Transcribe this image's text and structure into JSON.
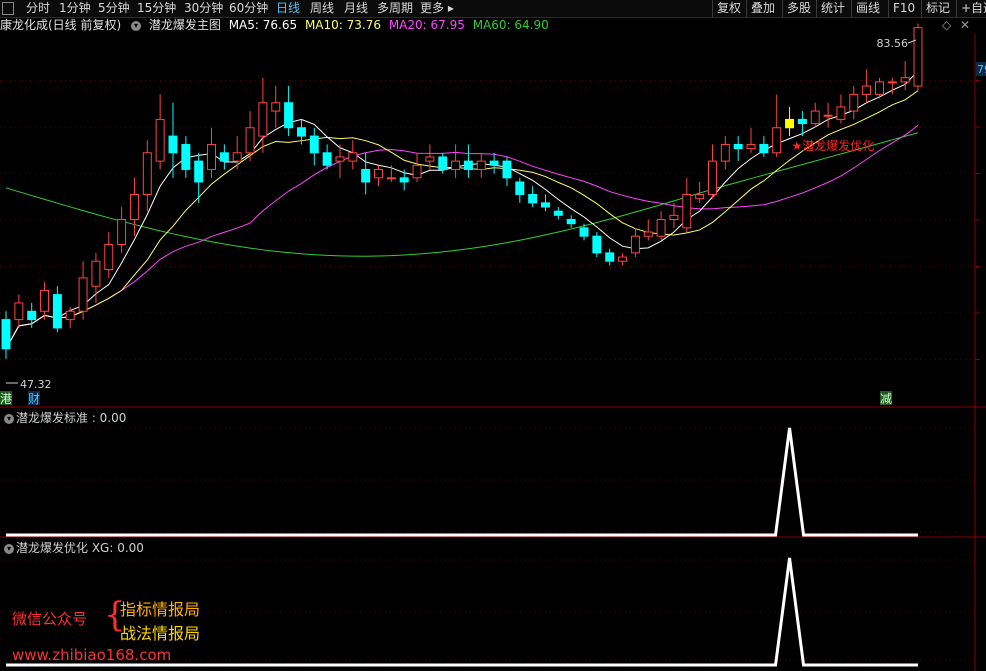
{
  "toolbar": {
    "left_items": [
      "分时",
      "1分钟",
      "5分钟",
      "15分钟",
      "30分钟",
      "60分钟",
      "日线",
      "周线",
      "月线",
      "多周期",
      "更多"
    ],
    "active": "日线",
    "more_caret": "▸",
    "right_items": [
      "复权",
      "叠加",
      "多股",
      "统计",
      "画线",
      "F10",
      "标记",
      "+自选"
    ]
  },
  "info": {
    "stock": "康龙化成(日线 前复权)",
    "indicator": "潜龙爆发主图",
    "ma5": "MA5: 76.65",
    "ma10": "MA10: 73.76",
    "ma20": "MA20: 67.95",
    "ma60": "MA60: 64.90",
    "right_icons": [
      "diamond-icon",
      "close-icon"
    ]
  },
  "colors": {
    "ma5": "#ffffff",
    "ma10": "#ffff66",
    "ma20": "#ff44ff",
    "ma60": "#33cc33",
    "up": "#ff4444",
    "down": "#00ffff",
    "signal": "#ffff00",
    "annotation": "#ff2222"
  },
  "main_chart": {
    "high_label": "83.56",
    "low_label": "47.32",
    "right_price": "79",
    "signal_text": "★潜龙爆发优化",
    "bottom_tags": [
      "港",
      "财",
      "减"
    ]
  },
  "chart_data": {
    "type": "candlestick",
    "ylim": [
      45,
      86
    ],
    "candles": [
      [
        52,
        48.5,
        53,
        47.3
      ],
      [
        52,
        54,
        55,
        51
      ],
      [
        53,
        52,
        54,
        51
      ],
      [
        53,
        55.5,
        56.5,
        52
      ],
      [
        55,
        51,
        56,
        50.5
      ],
      [
        52,
        53,
        53.5,
        51
      ],
      [
        53,
        57,
        59,
        52
      ],
      [
        56,
        59,
        60,
        54
      ],
      [
        58,
        61,
        62.5,
        57
      ],
      [
        61,
        64,
        65.5,
        60
      ],
      [
        64,
        67,
        69,
        62
      ],
      [
        67,
        72,
        73.5,
        65
      ],
      [
        71,
        76,
        79,
        70
      ],
      [
        74,
        72,
        78,
        69
      ],
      [
        73,
        70,
        74,
        69
      ],
      [
        71,
        68.5,
        72,
        66
      ],
      [
        70,
        73,
        75,
        69
      ],
      [
        72,
        71,
        73,
        70
      ],
      [
        71,
        72,
        74,
        70
      ],
      [
        72,
        75,
        77,
        71
      ],
      [
        74,
        78,
        81,
        72
      ],
      [
        77,
        78,
        80,
        75
      ],
      [
        78,
        75,
        80,
        74
      ],
      [
        75,
        74,
        76,
        73
      ],
      [
        74,
        72,
        75,
        70.5
      ],
      [
        72,
        70.5,
        73,
        70
      ],
      [
        71,
        71.5,
        73,
        69
      ],
      [
        71,
        72,
        73.5,
        70
      ],
      [
        70,
        68.5,
        72,
        67
      ],
      [
        69,
        70,
        70.5,
        68
      ],
      [
        69,
        69,
        70.5,
        68.5
      ],
      [
        69,
        68.5,
        70,
        67.5
      ],
      [
        69,
        70.5,
        72,
        68.5
      ],
      [
        71,
        71.5,
        73,
        70
      ],
      [
        71.5,
        70,
        72,
        69.5
      ],
      [
        70,
        71,
        73,
        69
      ],
      [
        71,
        70,
        73,
        69
      ],
      [
        70,
        71,
        72,
        69
      ],
      [
        71,
        70.5,
        72,
        69.5
      ],
      [
        71,
        69,
        71.5,
        68
      ],
      [
        68.5,
        67,
        69,
        66
      ],
      [
        67,
        66,
        68,
        65.5
      ],
      [
        66,
        65.5,
        67,
        65
      ],
      [
        65,
        64.5,
        65.5,
        64
      ],
      [
        64,
        63.5,
        64.5,
        63
      ],
      [
        63,
        62,
        63.5,
        61.5
      ],
      [
        62,
        60,
        62.5,
        59.5
      ],
      [
        60,
        59,
        60.5,
        58.5
      ],
      [
        59,
        59.5,
        60,
        58.5
      ],
      [
        60,
        62,
        63,
        59.5
      ],
      [
        62,
        62.5,
        64,
        61.5
      ],
      [
        62,
        64,
        65,
        61.5
      ],
      [
        64,
        64.5,
        66,
        63
      ],
      [
        63,
        67,
        69,
        62.5
      ],
      [
        66.5,
        67,
        68.5,
        66
      ],
      [
        67,
        71,
        73,
        66.5
      ],
      [
        71,
        73,
        74,
        70
      ],
      [
        73,
        72.5,
        74,
        71
      ],
      [
        72.5,
        73,
        75,
        72
      ],
      [
        73,
        72,
        74,
        71.5
      ],
      [
        72,
        75,
        79,
        71.5
      ],
      [
        75,
        76,
        77.5,
        74
      ],
      [
        76,
        75.5,
        77,
        74
      ],
      [
        75.5,
        77,
        78,
        75
      ],
      [
        76.5,
        76.5,
        78,
        75
      ],
      [
        76,
        77.5,
        79,
        75.5
      ],
      [
        77,
        79,
        80,
        76
      ],
      [
        79,
        80,
        82,
        78
      ],
      [
        79,
        80.5,
        81,
        78.5
      ],
      [
        80.5,
        80.5,
        81,
        79
      ],
      [
        80.5,
        81,
        83,
        79.5
      ],
      [
        80,
        87,
        87.5,
        79.5
      ]
    ],
    "signal_index": 61,
    "series": [
      {
        "name": "MA5",
        "key": "ma5"
      },
      {
        "name": "MA10",
        "key": "ma10"
      },
      {
        "name": "MA20",
        "key": "ma20"
      },
      {
        "name": "MA60",
        "key": "ma60"
      }
    ]
  },
  "panel2": {
    "label": "潜龙爆发标准 : 0.00",
    "values_peak_index": 61,
    "peak": 1
  },
  "panel3": {
    "label": "潜龙爆发优化 XG: 0.00",
    "values_peak_index": 61,
    "peak": 1
  },
  "watermark": {
    "left": "微信公众号",
    "brace": "{",
    "right1": "指标情报局",
    "right2": "战法情报局",
    "url": "www.zhibiao168.com"
  }
}
